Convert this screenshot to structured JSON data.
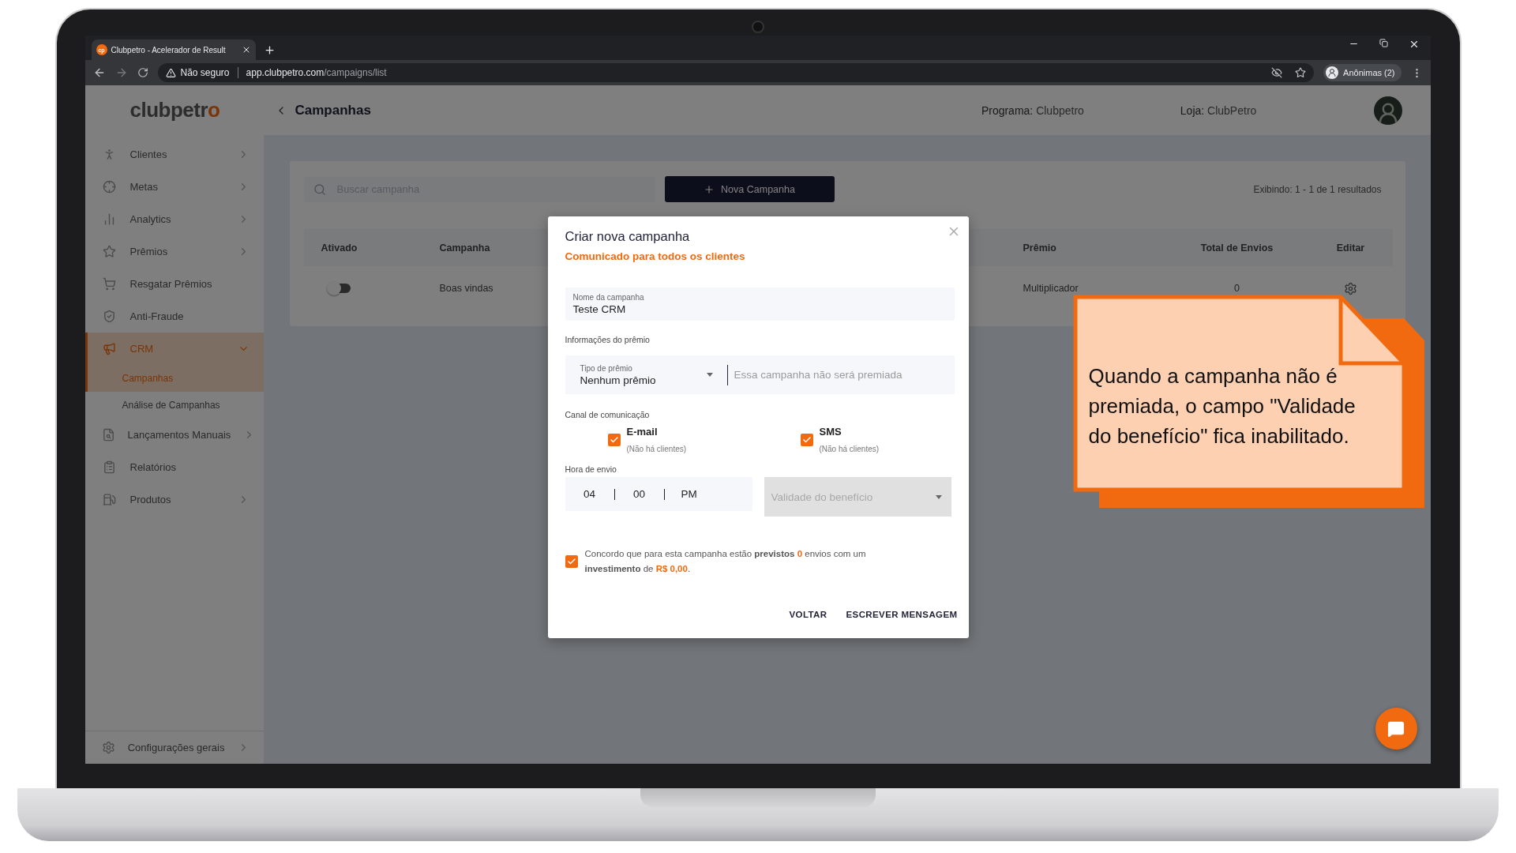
{
  "browser": {
    "tab": {
      "favicon": "cp",
      "title": "Clubpetro - Acelerador de Result"
    },
    "security": "Não seguro",
    "url_host": "app.clubpetro.com",
    "url_path": "/campaigns/list",
    "profile": "Anônimas (2)"
  },
  "logo": {
    "main": "clubpetr",
    "accent": "o"
  },
  "sidebar": {
    "items": [
      {
        "label": "Clientes",
        "kind": "menu",
        "expanded": false,
        "selected": false
      },
      {
        "label": "Metas",
        "kind": "menu",
        "expanded": false,
        "selected": false
      },
      {
        "label": "Analytics",
        "kind": "menu",
        "expanded": false,
        "selected": false
      },
      {
        "label": "Prêmios",
        "kind": "menu",
        "expanded": false,
        "selected": false
      },
      {
        "label": "Resgatar Prêmios",
        "kind": "link",
        "selected": false
      },
      {
        "label": "Anti-Fraude",
        "kind": "link",
        "selected": false
      },
      {
        "label": "CRM",
        "kind": "menu",
        "expanded": true,
        "selected": true,
        "children": [
          {
            "label": "Campanhas",
            "selected": true
          },
          {
            "label": "Análise de Campanhas",
            "selected": false
          }
        ]
      },
      {
        "label": "Lançamentos Manuais",
        "kind": "menu",
        "expanded": false,
        "selected": false
      },
      {
        "label": "Relatórios",
        "kind": "link",
        "selected": false
      },
      {
        "label": "Produtos",
        "kind": "menu",
        "expanded": false,
        "selected": false
      }
    ],
    "footer": {
      "label": "Configurações gerais",
      "kind": "menu",
      "expanded": false
    }
  },
  "header": {
    "title": "Campanhas",
    "program": {
      "label": "Programa:",
      "value": "Clubpetro"
    },
    "store": {
      "label": "Loja:",
      "value": "ClubPetro"
    }
  },
  "toolbar": {
    "search": {
      "placeholder": "Buscar campanha"
    },
    "new_button": "Nova Campanha",
    "results": "Exibindo: 1 - 1 de 1 resultados"
  },
  "table": {
    "columns": [
      "Ativado",
      "Campanha",
      "Prêmio",
      "Total de Envios",
      "Editar"
    ],
    "rows": [
      {
        "active": false,
        "campaign": "Boas vindas",
        "prize": "Multiplicador",
        "total": "0"
      }
    ]
  },
  "modal": {
    "title": "Criar nova campanha",
    "subtitle": "Comunicado para todos os clientes",
    "name_field": {
      "label": "Nome da campanha",
      "value": "Teste CRM"
    },
    "prize_section": "Informações do prêmio",
    "prize_type": {
      "label": "Tipo de prêmio",
      "value": "Nenhum prêmio"
    },
    "prize_note": {
      "placeholder": "Essa campanha não será premiada"
    },
    "channel_section": "Canal de comunicação",
    "channels": [
      {
        "name": "E-mail",
        "note": "(Não há clientes)",
        "checked": true
      },
      {
        "name": "SMS",
        "note": "(Não há clientes)",
        "checked": true
      }
    ],
    "time_section": "Hora de envio",
    "time": {
      "hour": "04",
      "minute": "00",
      "period": "PM"
    },
    "validity": {
      "placeholder": "Validade do benefício",
      "disabled": true
    },
    "agreement": {
      "checked": true,
      "parts": [
        {
          "kind": "plain",
          "text": "Concordo que para esta campanha estão "
        },
        {
          "kind": "bold",
          "text": "previstos "
        },
        {
          "kind": "accent",
          "text": "0"
        },
        {
          "kind": "plain",
          "text": " envios com um "
        },
        {
          "kind": "bold",
          "text": "investimento"
        },
        {
          "kind": "plain",
          "text": " de "
        },
        {
          "kind": "accent",
          "text": "R$ 0,00"
        },
        {
          "kind": "plain",
          "text": "."
        }
      ]
    },
    "buttons": [
      "VOLTAR",
      "ESCREVER MENSAGEM"
    ]
  },
  "callout": {
    "text": "Quando a campanha não é premiada, o campo \"Validade do benefício\" fica inabilitado."
  }
}
